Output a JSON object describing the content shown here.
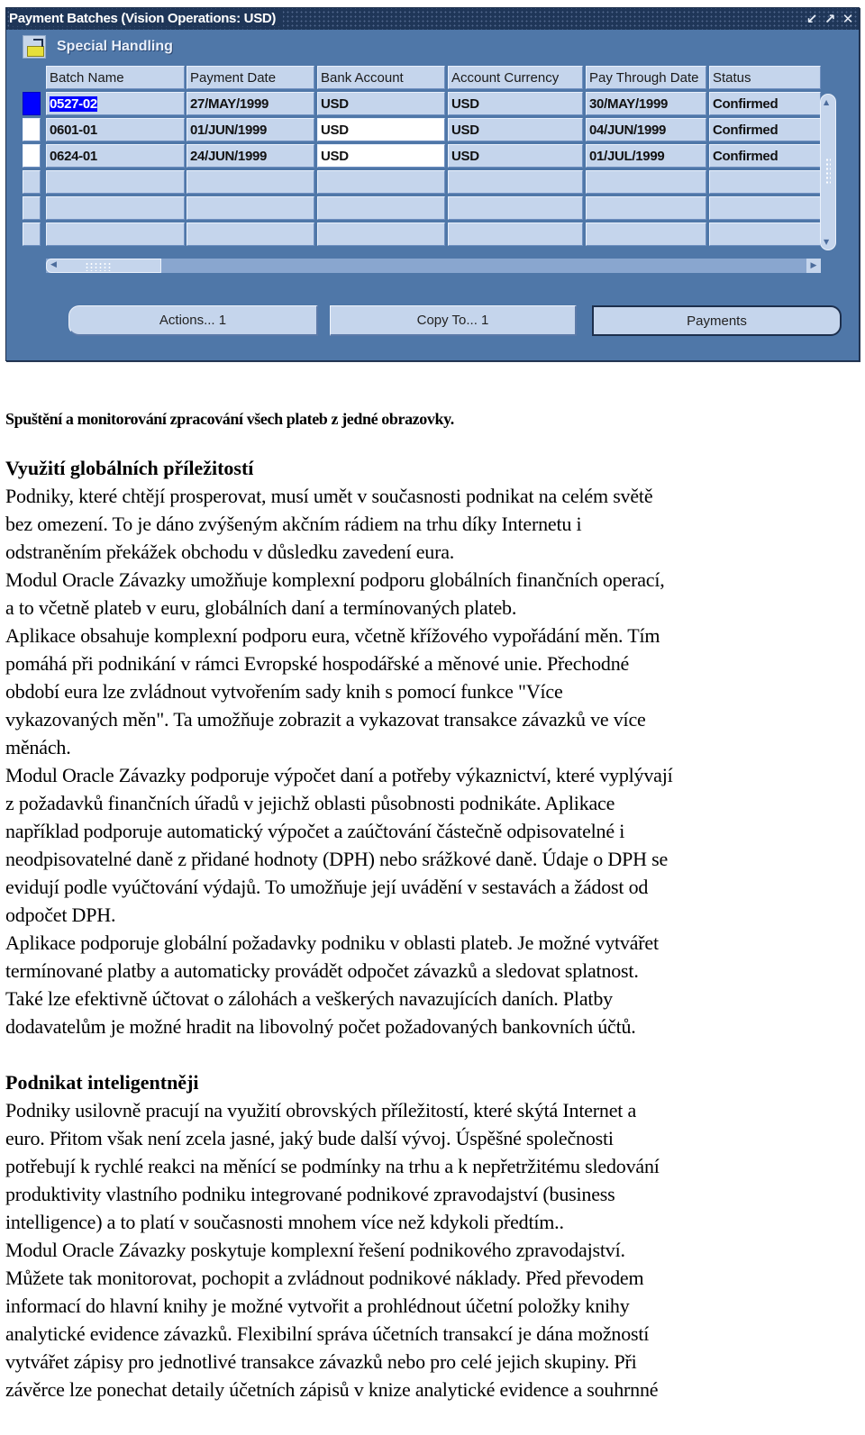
{
  "window": {
    "title": "Payment Batches (Vision Operations: USD)",
    "controls": [
      "minimize-icon",
      "maximize-icon",
      "close-icon"
    ],
    "section_title": "Special Handling",
    "columns": [
      "Batch Name",
      "Payment Date",
      "Bank Account",
      "Account Currency",
      "Pay Through Date",
      "Status"
    ],
    "rows": [
      [
        "0527-02",
        "27/MAY/1999",
        "USD",
        "USD",
        "30/MAY/1999",
        "Confirmed"
      ],
      [
        "0601-01",
        "01/JUN/1999",
        "USD",
        "USD",
        "04/JUN/1999",
        "Confirmed"
      ],
      [
        "0624-01",
        "24/JUN/1999",
        "USD",
        "USD",
        "01/JUL/1999",
        "Confirmed"
      ],
      [
        "",
        "",
        "",
        "",
        "",
        ""
      ],
      [
        "",
        "",
        "",
        "",
        "",
        ""
      ],
      [
        "",
        "",
        "",
        "",
        "",
        ""
      ]
    ],
    "selected_row": 0,
    "buttons": {
      "actions": "Actions... 1",
      "copy_to": "Copy To... 1",
      "payments": "Payments"
    }
  },
  "document": {
    "caption": "Spuštění a monitorování zpracování všech plateb z jedné obrazovky.",
    "sections": [
      {
        "heading": "Využití globálních příležitostí",
        "lines": [
          "Podniky, které chtějí prosperovat, musí umět v současnosti podnikat na celém světě",
          "bez omezení. To je dáno zvýšeným akčním rádiem na trhu díky Internetu i",
          "odstraněním překážek obchodu v důsledku zavedení eura.",
          "Modul Oracle Závazky umožňuje komplexní podporu globálních finančních operací,",
          "a to včetně plateb v euru, globálních daní a termínovaných plateb.",
          "Aplikace obsahuje komplexní podporu eura, včetně křížového vypořádání měn. Tím",
          "pomáhá při podnikání v rámci Evropské hospodářské a měnové unie. Přechodné",
          "období eura lze zvládnout vytvořením sady knih s pomocí funkce \"Více",
          "vykazovaných měn\". Ta umožňuje zobrazit a vykazovat transakce závazků ve více",
          "měnách.",
          "Modul Oracle Závazky podporuje výpočet daní a potřeby výkaznictví, které vyplývají",
          "z požadavků finančních úřadů v jejichž oblasti působnosti podnikáte. Aplikace",
          "například podporuje automatický výpočet a zaúčtování částečně odpisovatelné i",
          "neodpisovatelné daně z přidané hodnoty (DPH) nebo srážkové daně. Údaje o DPH se",
          "evidují podle vyúčtování výdajů. To umožňuje její uvádění v sestavách a žádost od",
          "odpočet DPH.",
          "Aplikace podporuje globální požadavky podniku v oblasti plateb. Je možné vytvářet",
          "termínované platby a automaticky provádět odpočet závazků a sledovat splatnost.",
          "Také lze efektivně účtovat o zálohách a veškerých navazujících daních. Platby",
          "dodavatelům je možné hradit na libovolný počet požadovaných bankovních účtů."
        ]
      },
      {
        "heading": "Podnikat inteligentněji",
        "lines": [
          "Podniky usilovně pracují na využití obrovských příležitostí, které skýtá Internet a",
          "euro. Přitom však není zcela jasné, jaký bude další vývoj. Úspěšné společnosti",
          "potřebují k rychlé reakci na měnící se podmínky na trhu a k nepřetržitému sledování",
          "produktivity vlastního podniku integrované podnikové zpravodajství (business",
          "intelligence) a to platí v současnosti  mnohem více než kdykoli předtím..",
          "Modul Oracle Závazky poskytuje komplexní řešení podnikového zpravodajství.",
          "Můžete tak monitorovat, pochopit a zvládnout podnikové náklady. Před převodem",
          "informací do hlavní knihy je možné vytvořit a prohlédnout účetní položky knihy",
          "analytické evidence závazků. Flexibilní správa účetních transakcí je dána možností",
          "vytvářet zápisy pro jednotlivé transakce závazků nebo pro celé jejich skupiny. Při",
          "závěrce lze ponechat detaily účetních zápisů v knize analytické evidence a souhrnné"
        ]
      }
    ]
  }
}
